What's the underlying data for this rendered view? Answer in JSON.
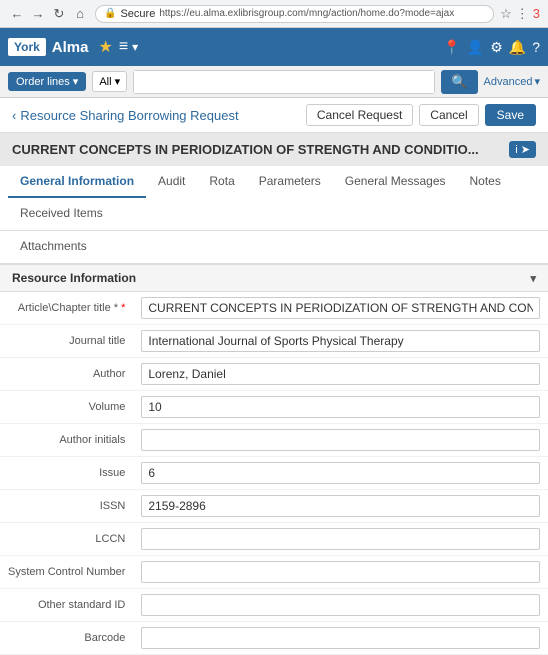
{
  "browser": {
    "url": "https://eu.alma.exlibrisgroup.com/mng/action/home.do?mode=ajax",
    "secure_label": "Secure"
  },
  "alma_nav": {
    "york_label": "York",
    "title": "Alma",
    "hamburger": "≡",
    "down_arrow": "▾"
  },
  "action_bar": {
    "order_lines_label": "Order lines",
    "all_label": "All",
    "search_icon": "🔍",
    "advanced_label": "Advanced"
  },
  "page_header": {
    "back_icon": "‹",
    "title": "Resource Sharing Borrowing Request",
    "cancel_request_label": "Cancel Request",
    "cancel_label": "Cancel",
    "save_label": "Save"
  },
  "record_title": "CURRENT CONCEPTS IN PERIODIZATION OF STRENGTH AND CONDITIO...",
  "tabs": {
    "row1": [
      {
        "id": "general-information",
        "label": "General Information",
        "active": true
      },
      {
        "id": "audit",
        "label": "Audit",
        "active": false
      },
      {
        "id": "rota",
        "label": "Rota",
        "active": false
      },
      {
        "id": "parameters",
        "label": "Parameters",
        "active": false
      },
      {
        "id": "general-messages",
        "label": "General Messages",
        "active": false
      },
      {
        "id": "notes",
        "label": "Notes",
        "active": false
      },
      {
        "id": "received-items",
        "label": "Received Items",
        "active": false
      }
    ],
    "row2": [
      {
        "id": "attachments",
        "label": "Attachments",
        "active": false
      }
    ]
  },
  "section": {
    "label": "Resource Information",
    "collapsed": false
  },
  "fields": [
    {
      "label": "Article\\Chapter title",
      "required": true,
      "value": "CURRENT CONCEPTS IN PERIODIZATION OF STRENGTH AND CONDITIONING FOR THE SPORTS PHYS"
    },
    {
      "label": "Journal title",
      "required": false,
      "value": "International Journal of Sports Physical Therapy"
    },
    {
      "label": "Author",
      "required": false,
      "value": "Lorenz, Daniel"
    },
    {
      "label": "Volume",
      "required": false,
      "value": "10"
    },
    {
      "label": "Author initials",
      "required": false,
      "value": ""
    },
    {
      "label": "Issue",
      "required": false,
      "value": "6"
    },
    {
      "label": "ISSN",
      "required": false,
      "value": "2159-2896"
    },
    {
      "label": "LCCN",
      "required": false,
      "value": ""
    },
    {
      "label": "System Control Number",
      "required": false,
      "value": ""
    },
    {
      "label": "Other standard ID",
      "required": false,
      "value": ""
    },
    {
      "label": "Barcode",
      "required": false,
      "value": ""
    }
  ]
}
